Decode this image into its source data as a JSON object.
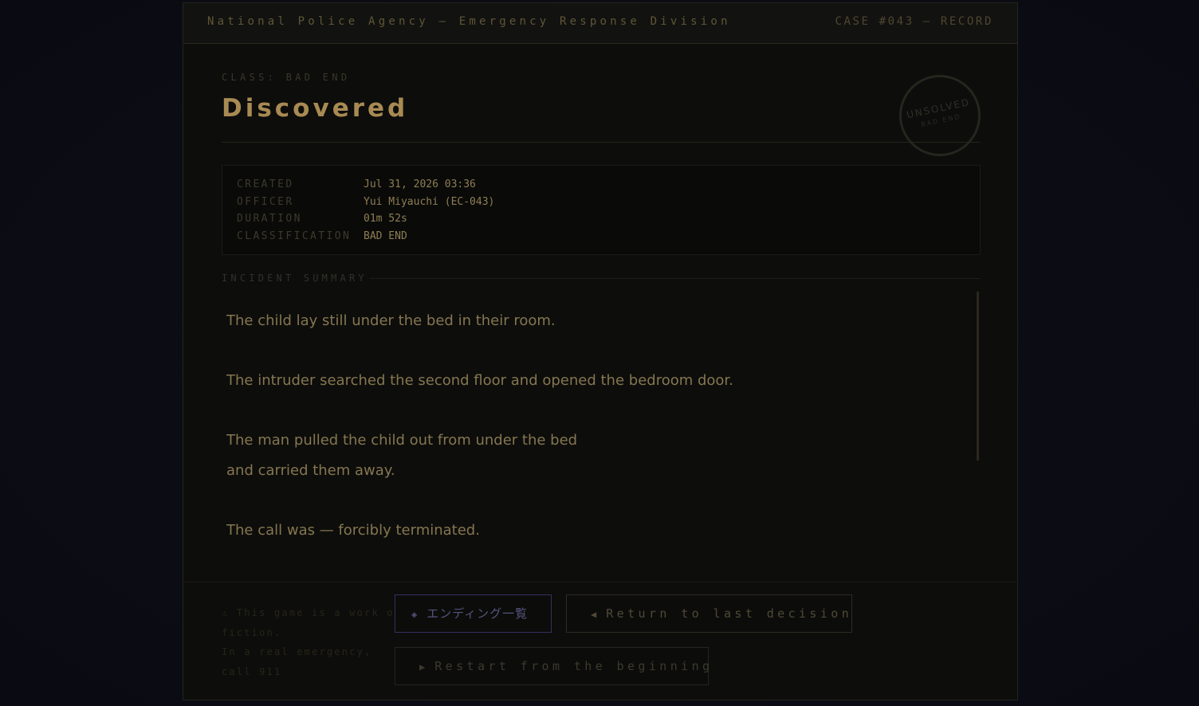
{
  "header": {
    "agency": "National Police Agency — Emergency Response Division",
    "case_label": "CASE #043 — RECORD"
  },
  "record": {
    "class_line": "CLASS: BAD END",
    "title": "Discovered",
    "stamp": {
      "main": "UNSOLVED",
      "sub": "BAD END"
    }
  },
  "meta": [
    {
      "key": "CREATED",
      "value": "Jul 31, 2026 03:36"
    },
    {
      "key": "OFFICER",
      "value": "Yui Miyauchi (EC-043)"
    },
    {
      "key": "DURATION",
      "value": "01m 52s"
    },
    {
      "key": "CLASSIFICATION",
      "value": "BAD END"
    }
  ],
  "summary": {
    "heading": "INCIDENT SUMMARY",
    "lines": [
      "The child lay still under the bed in their room.",
      "The intruder searched the second floor and opened the bedroom door.",
      "The man pulled the child out from under the bed",
      "and carried them away.",
      "The call was — forcibly terminated."
    ]
  },
  "footer": {
    "disclaimer_line1": "⚠ This game is a work of fiction.",
    "disclaimer_line2": "In a real emergency, call 911"
  },
  "buttons": {
    "endings": {
      "icon": "◈",
      "icon_name": "diamond-icon",
      "label": "エンディング一覧"
    },
    "return": {
      "icon": "◀",
      "icon_name": "back-triangle-icon",
      "label": "Return to last decision"
    },
    "restart": {
      "icon": "▶",
      "icon_name": "play-triangle-icon",
      "label": "Restart from the beginning"
    }
  },
  "colors": {
    "title": "#a88a53",
    "accent_button_border": "#343262",
    "background": "#0c0c14"
  }
}
